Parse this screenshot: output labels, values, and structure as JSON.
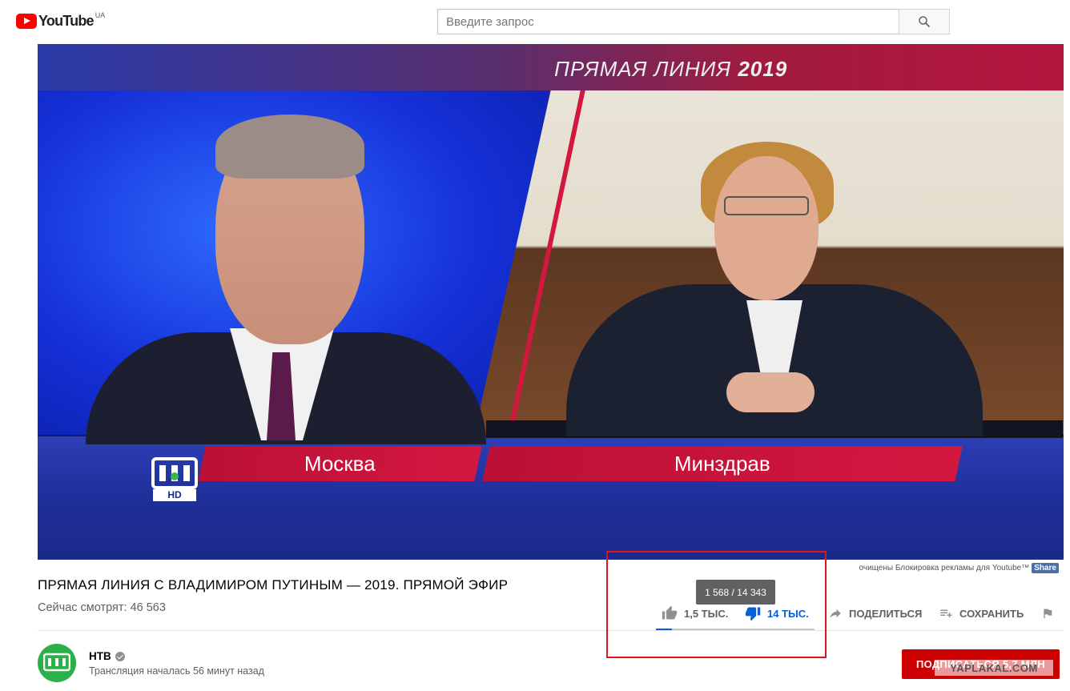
{
  "header": {
    "logo_text": "YouTube",
    "region": "UA",
    "search_placeholder": "Введите запрос"
  },
  "video": {
    "heading_prefix": "ПРЯМАЯ ЛИНИЯ",
    "heading_year": "2019",
    "caption_left": "Москва",
    "caption_right": "Минздрав",
    "channel_logo_hd": "HD"
  },
  "ad_note": {
    "text": "очищены Блокировка рекламы для Youtube™",
    "share_label": "Share"
  },
  "info": {
    "title": "ПРЯМАЯ ЛИНИЯ С ВЛАДИМИРОМ ПУТИНЫМ — 2019. ПРЯМОЙ ЭФИР",
    "viewers": "Сейчас смотрят: 46 563",
    "tooltip": "1 568 / 14 343",
    "likes": "1,5 ТЫС.",
    "dislikes": "14 ТЫС.",
    "like_ratio": 0.099,
    "share_label": "ПОДЕЛИТЬСЯ",
    "save_label": "СОХРАНИТЬ"
  },
  "channel": {
    "name": "НТВ",
    "stream_started": "Трансляция началась 56 минут назад",
    "subscribe_label": "ПОДПИСАТЬСЯ  5,7 МЛН",
    "watermark": "YAPLAKAL.COM"
  },
  "colors": {
    "brand_red": "#ff0000",
    "subscribe_red": "#cc0000",
    "accent_blue": "#065fd4",
    "highlight_red": "#e0141a"
  }
}
